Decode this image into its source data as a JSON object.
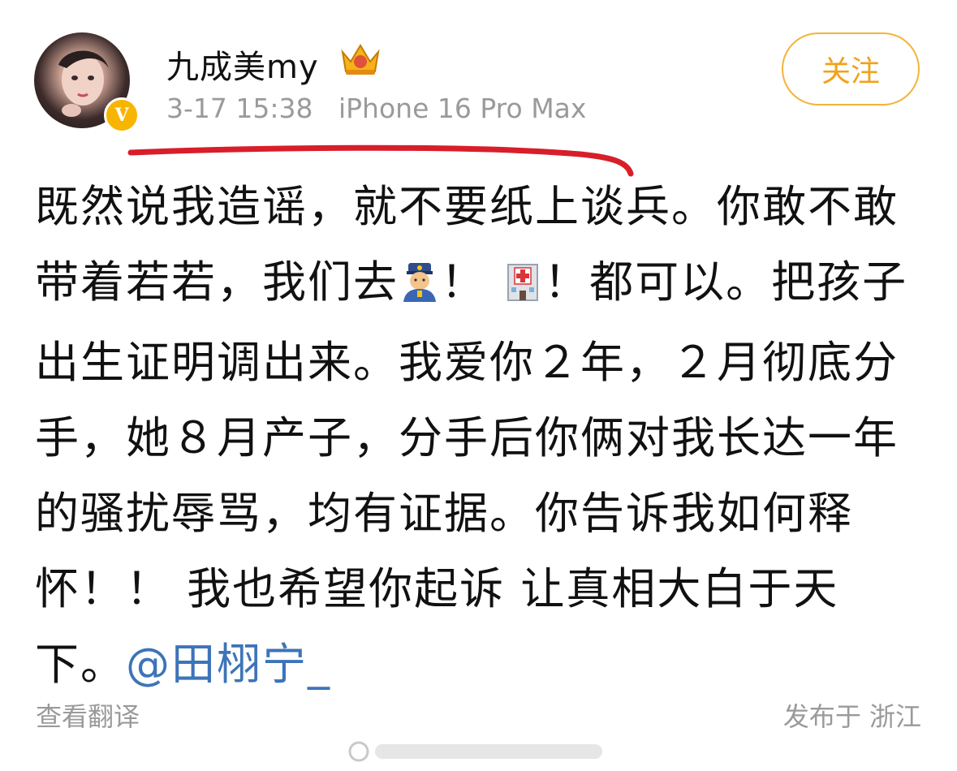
{
  "author": {
    "name": "九成美my",
    "verified_badge": "V",
    "crown_icon": "crown-badge-icon"
  },
  "meta": {
    "timestamp": "3-17 15:38",
    "device": "iPhone 16 Pro Max"
  },
  "follow_button": {
    "label": "关注"
  },
  "post": {
    "seg1": "既然说我造谣，就不要纸上谈兵。你敢不敢带着若若，我们去",
    "emoji_police": "police-officer-emoji",
    "seg2": "！",
    "emoji_hospital": "hospital-emoji",
    "seg3": "！都可以。把孩子出生证明调出来。我爱你２年，２月彻底分手，她８月产子，分手后你俩对我长达一年的骚扰辱骂，均有证据。你告诉我如何释怀！！ 我也希望你起诉 让真相大白于天下。",
    "mention": "@田栩宁_"
  },
  "footer": {
    "translate": "查看翻译",
    "location": "发布于 浙江"
  },
  "colors": {
    "accent_orange": "#f0a21a",
    "mention_blue": "#3d74b8",
    "meta_gray": "#9a9a9a",
    "annotation_red": "#d81e2a"
  }
}
